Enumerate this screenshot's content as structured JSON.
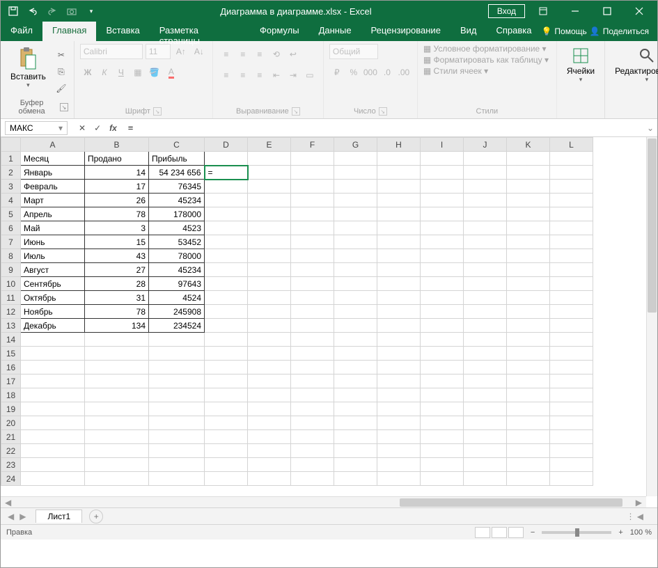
{
  "title": "Диаграмма в диаграмме.xlsx  -  Excel",
  "signin": "Вход",
  "tabs": {
    "file": "Файл",
    "home": "Главная",
    "insert": "Вставка",
    "layout": "Разметка страницы",
    "formulas": "Формулы",
    "data": "Данные",
    "review": "Рецензирование",
    "view": "Вид",
    "help": "Справка"
  },
  "help_links": {
    "tell": "Помощь",
    "share": "Поделиться"
  },
  "ribbon": {
    "clipboard": {
      "paste": "Вставить",
      "group": "Буфер обмена"
    },
    "font": {
      "name": "Calibri",
      "size": "11",
      "group": "Шрифт"
    },
    "align": {
      "group": "Выравнивание"
    },
    "number": {
      "format": "Общий",
      "group": "Число"
    },
    "styles": {
      "cond": "Условное форматирование",
      "table": "Форматировать как таблицу",
      "cell": "Стили ячеек",
      "group": "Стили"
    },
    "cells": {
      "label": "Ячейки"
    },
    "editing": {
      "label": "Редактирование"
    }
  },
  "namebox": "МАКС",
  "formula": "=",
  "columns": [
    "A",
    "B",
    "C",
    "D",
    "E",
    "F",
    "G",
    "H",
    "I",
    "J",
    "K",
    "L"
  ],
  "headers": {
    "a": "Месяц",
    "b": "Продано",
    "c": "Прибыль"
  },
  "rows": [
    {
      "a": "Январь",
      "b": "14",
      "c": "54 234 656"
    },
    {
      "a": "Февраль",
      "b": "17",
      "c": "76345"
    },
    {
      "a": "Март",
      "b": "26",
      "c": "45234"
    },
    {
      "a": "Апрель",
      "b": "78",
      "c": "178000"
    },
    {
      "a": "Май",
      "b": "3",
      "c": "4523"
    },
    {
      "a": "Июнь",
      "b": "15",
      "c": "53452"
    },
    {
      "a": "Июль",
      "b": "43",
      "c": "78000"
    },
    {
      "a": "Август",
      "b": "27",
      "c": "45234"
    },
    {
      "a": "Сентябрь",
      "b": "28",
      "c": "97643"
    },
    {
      "a": "Октябрь",
      "b": "31",
      "c": "4524"
    },
    {
      "a": "Ноябрь",
      "b": "78",
      "c": "245908"
    },
    {
      "a": "Декабрь",
      "b": "134",
      "c": "234524"
    }
  ],
  "active_cell_value": "=",
  "sheet_tab": "Лист1",
  "status": "Правка",
  "zoom": "100 %"
}
